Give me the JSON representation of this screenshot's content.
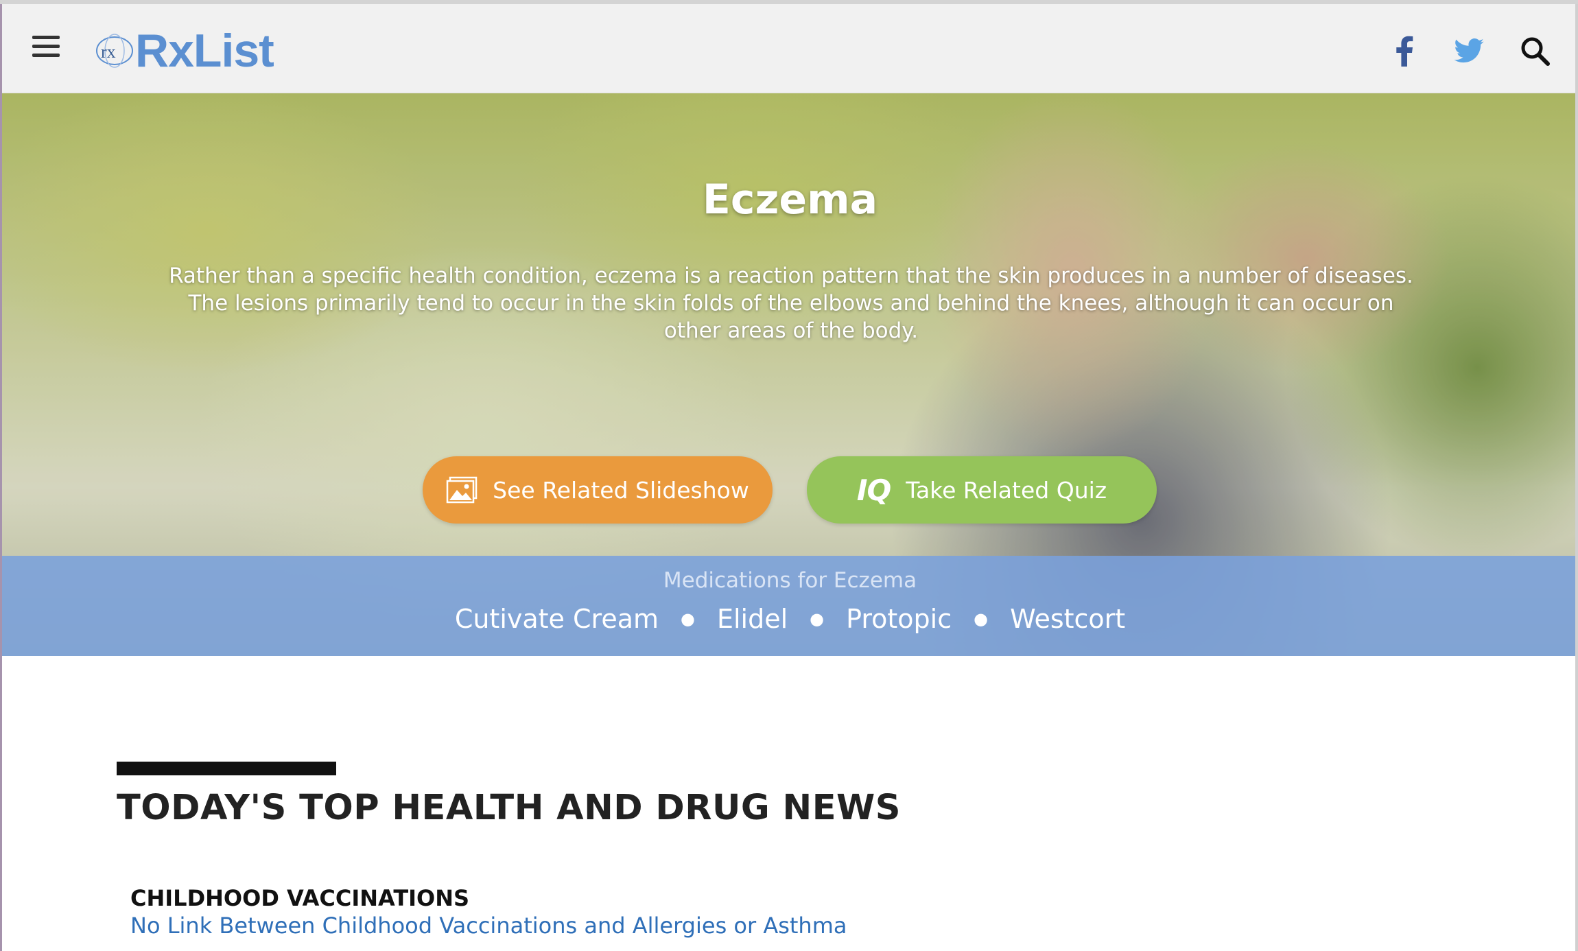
{
  "header": {
    "logo_text": "RxList",
    "logo_mark": "rx",
    "icons": {
      "menu": "hamburger-menu-icon",
      "facebook": "facebook-icon",
      "twitter": "twitter-icon",
      "search": "search-icon"
    },
    "colors": {
      "logo": "#5b8fd1",
      "facebook": "#3b5998",
      "twitter": "#5ba4e5"
    }
  },
  "hero": {
    "title": "Eczema",
    "description": "Rather than a specific health condition, eczema is a reaction pattern that the skin produces in a number of diseases. The lesions primarily tend to occur in the skin folds of the elbows and behind the knees, although it can occur on other areas of the body.",
    "buttons": {
      "slideshow": {
        "label": "See Related Slideshow",
        "icon": "slideshow-image-icon",
        "color": "#ea9a3d"
      },
      "quiz": {
        "label": "Take Related Quiz",
        "icon_text": "IQ",
        "color": "#95c45a"
      }
    }
  },
  "medications": {
    "label": "Medications for Eczema",
    "items": [
      "Cutivate Cream",
      "Elidel",
      "Protopic",
      "Westcort"
    ]
  },
  "news": {
    "heading": "TODAY'S TOP HEALTH AND DRUG NEWS",
    "items": [
      {
        "category": "CHILDHOOD VACCINATIONS",
        "headline": "No Link Between Childhood Vaccinations and Allergies or Asthma"
      }
    ]
  }
}
